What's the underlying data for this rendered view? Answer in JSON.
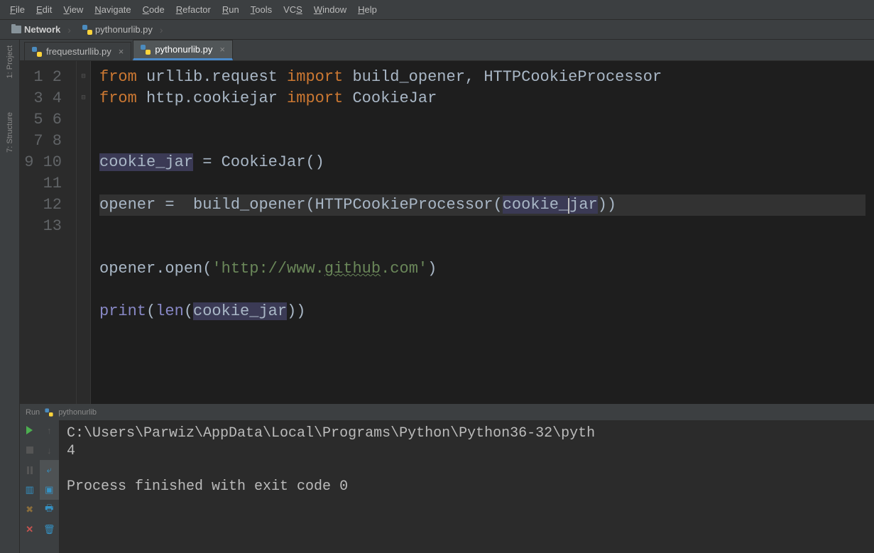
{
  "menu": [
    "File",
    "Edit",
    "View",
    "Navigate",
    "Code",
    "Refactor",
    "Run",
    "Tools",
    "VCS",
    "Window",
    "Help"
  ],
  "menu_underline_idx": [
    0,
    0,
    0,
    0,
    0,
    0,
    0,
    0,
    2,
    0,
    0
  ],
  "breadcrumb": {
    "project": "Network",
    "file": "pythonurlib.py"
  },
  "tabs": [
    {
      "label": "frequesturllib.py",
      "active": false
    },
    {
      "label": "pythonurlib.py",
      "active": true
    }
  ],
  "sidebar": {
    "project": "1: Project",
    "structure": "7: Structure"
  },
  "code": {
    "line_count": 13,
    "highlight_line": 7,
    "tokens": {
      "from": "from",
      "import": "import",
      "mod1": "urllib.request",
      "build_opener": "build_opener",
      "comma": ", ",
      "httpcp": "HTTPCookieProcessor",
      "mod2": "http.cookiejar",
      "cookiejar_cls": "CookieJar",
      "cookie_jar": "cookie_jar",
      "eq": " = ",
      "paren": "()",
      "opener": "opener",
      "eq2": " =  ",
      "bo": "build_opener",
      "lp": "(",
      "rp": ")",
      "cj_pre": "cookie_",
      "cj_post": "jar",
      "open": "open",
      "url": "'http://www.",
      "github": "github",
      ".com": ".com'",
      "print": "print",
      "len": "len"
    }
  },
  "run": {
    "title": "Run",
    "config": "pythonurlib",
    "output_line1": "C:\\Users\\Parwiz\\AppData\\Local\\Programs\\Python\\Python36-32\\pyth",
    "output_line2": "4",
    "output_line3": "",
    "output_line4": "Process finished with exit code 0"
  }
}
